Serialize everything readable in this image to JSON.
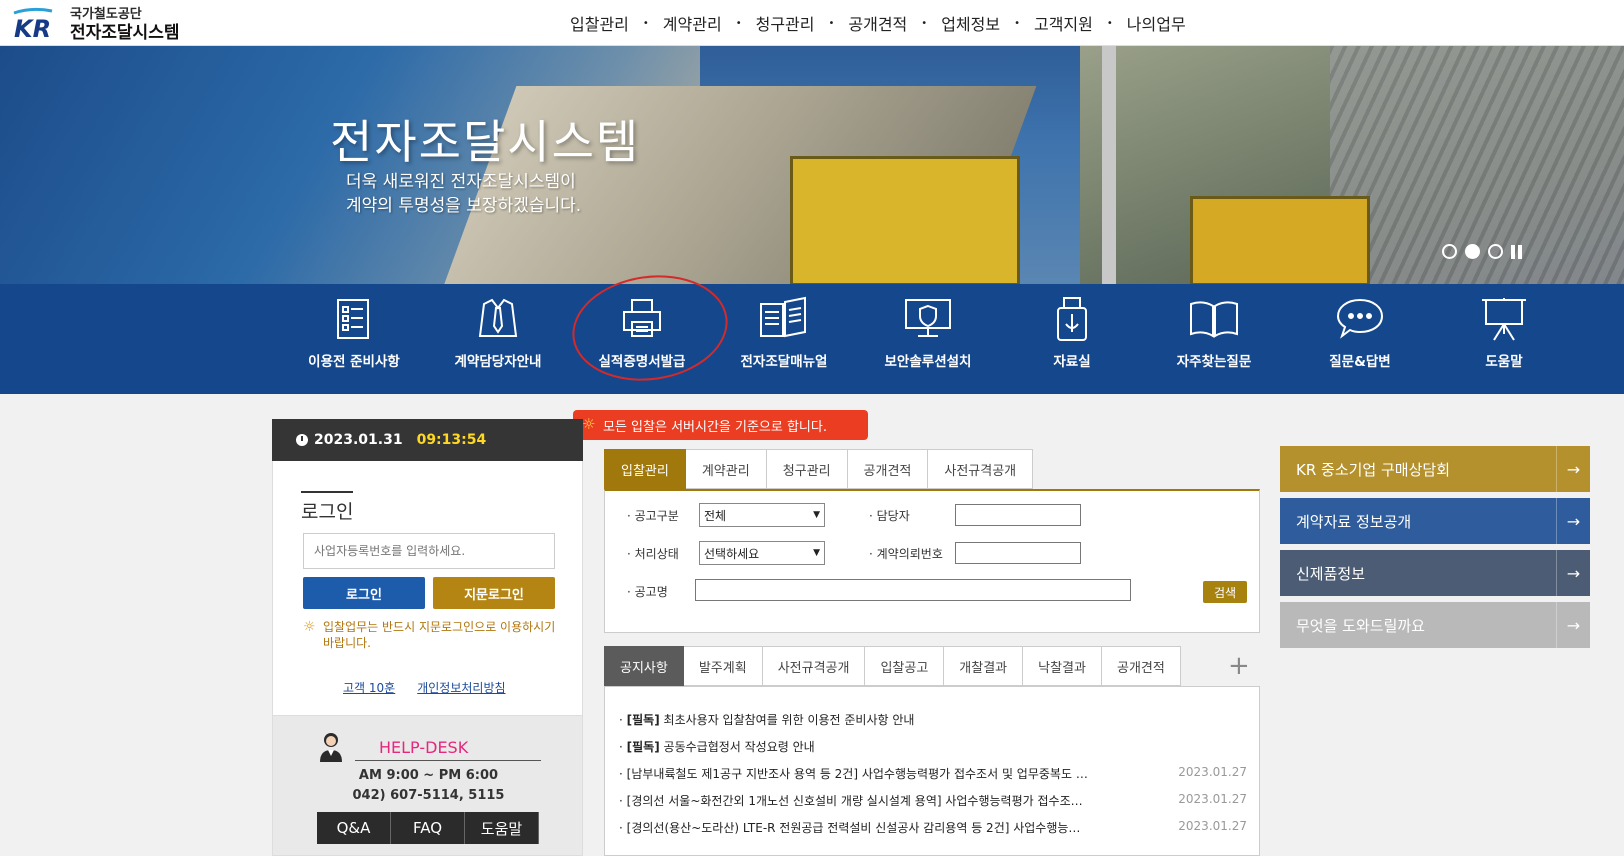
{
  "header": {
    "logo_sub": "국가철도공단",
    "logo_main": "전자조달시스템",
    "logo_mark": "KR",
    "nav": [
      "입찰관리",
      "계약관리",
      "청구관리",
      "공개견적",
      "업체정보",
      "고객지원",
      "나의업무"
    ]
  },
  "banner": {
    "title": "전자조달시스템",
    "subtitle_1": "더욱 새로워진 전자조달시스템이",
    "subtitle_2": "계약의 투명성을 보장하겠습니다.",
    "slides": 3,
    "active_slide": 2
  },
  "quick_menu": [
    {
      "label": "이용전 준비사항",
      "icon": "checklist-icon"
    },
    {
      "label": "계약담당자안내",
      "icon": "shirt-tie-icon"
    },
    {
      "label": "실적증명서발급",
      "icon": "printer-icon"
    },
    {
      "label": "전자조달매뉴얼",
      "icon": "book-icon"
    },
    {
      "label": "보안솔루션설치",
      "icon": "monitor-shield-icon"
    },
    {
      "label": "자료실",
      "icon": "usb-icon"
    },
    {
      "label": "자주찾는질문",
      "icon": "open-book-icon"
    },
    {
      "label": "질문&답변",
      "icon": "speech-bubble-icon"
    },
    {
      "label": "도움말",
      "icon": "presentation-board-icon"
    }
  ],
  "clock": {
    "date": "2023.01.31",
    "time": "09:13:54"
  },
  "server_notice": "모든 입찰은 서버시간을 기준으로 합니다.",
  "login": {
    "title": "로그인",
    "placeholder": "사업자등록번호를 입력하세요.",
    "login_btn": "로그인",
    "finger_btn": "지문로그인",
    "note": "입찰업무는 반드시 지문로그인으로 이용하시기 바랍니다.",
    "link_terms": "고객 10훈",
    "link_privacy": "개인정보처리방침"
  },
  "helpdesk": {
    "title": "HELP-DESK",
    "hours": "AM 9:00 ~ PM 6:00",
    "phone": "042) 607-5114, 5115",
    "buttons": [
      "Q&A",
      "FAQ",
      "도움말"
    ]
  },
  "search": {
    "tabs": [
      "입찰관리",
      "계약관리",
      "청구관리",
      "공개견적",
      "사전규격공개"
    ],
    "active_tab": 0,
    "label_type": "· 공고구분",
    "type_value": "전체",
    "label_manager": "· 담당자",
    "label_status": "· 처리상태",
    "status_value": "선택하세요",
    "label_request_no": "· 계약의뢰번호",
    "label_title": "· 공고명",
    "search_btn": "검색"
  },
  "notices": {
    "tabs": [
      "공지사항",
      "발주계획",
      "사전규격공개",
      "입찰공고",
      "개찰결과",
      "낙찰결과",
      "공개견적"
    ],
    "active_tab": 0,
    "items": [
      {
        "tag": "[필독]",
        "title": "최초사용자 입찰참여를 위한 이용전 준비사항 안내",
        "date": ""
      },
      {
        "tag": "[필독]",
        "title": "공동수급협정서 작성요령 안내",
        "date": ""
      },
      {
        "tag": "",
        "title": "[남부내륙철도 제1공구 지반조사 용역 등 2건] 사업수행능력평가 접수조서 및 업무중복도 …",
        "date": "2023.01.27"
      },
      {
        "tag": "",
        "title": "[경의선 서울~화전간외 1개노선 신호설비 개량 실시설계 용역] 사업수행능력평가 접수조…",
        "date": "2023.01.27"
      },
      {
        "tag": "",
        "title": "[경의선(용산~도라산) LTE-R 전원공급 전력설비 신설공사 감리용역 등 2건] 사업수행능…",
        "date": "2023.01.27"
      }
    ]
  },
  "right_links": [
    {
      "label": "KR 중소기업 구매상담회",
      "color": "#b4912d"
    },
    {
      "label": "계약자료 정보공개",
      "color": "#2e5c9c"
    },
    {
      "label": "신제품정보",
      "color": "#4c5c74"
    },
    {
      "label": "무엇을 도와드릴까요",
      "color": "#b9b9b9"
    }
  ]
}
